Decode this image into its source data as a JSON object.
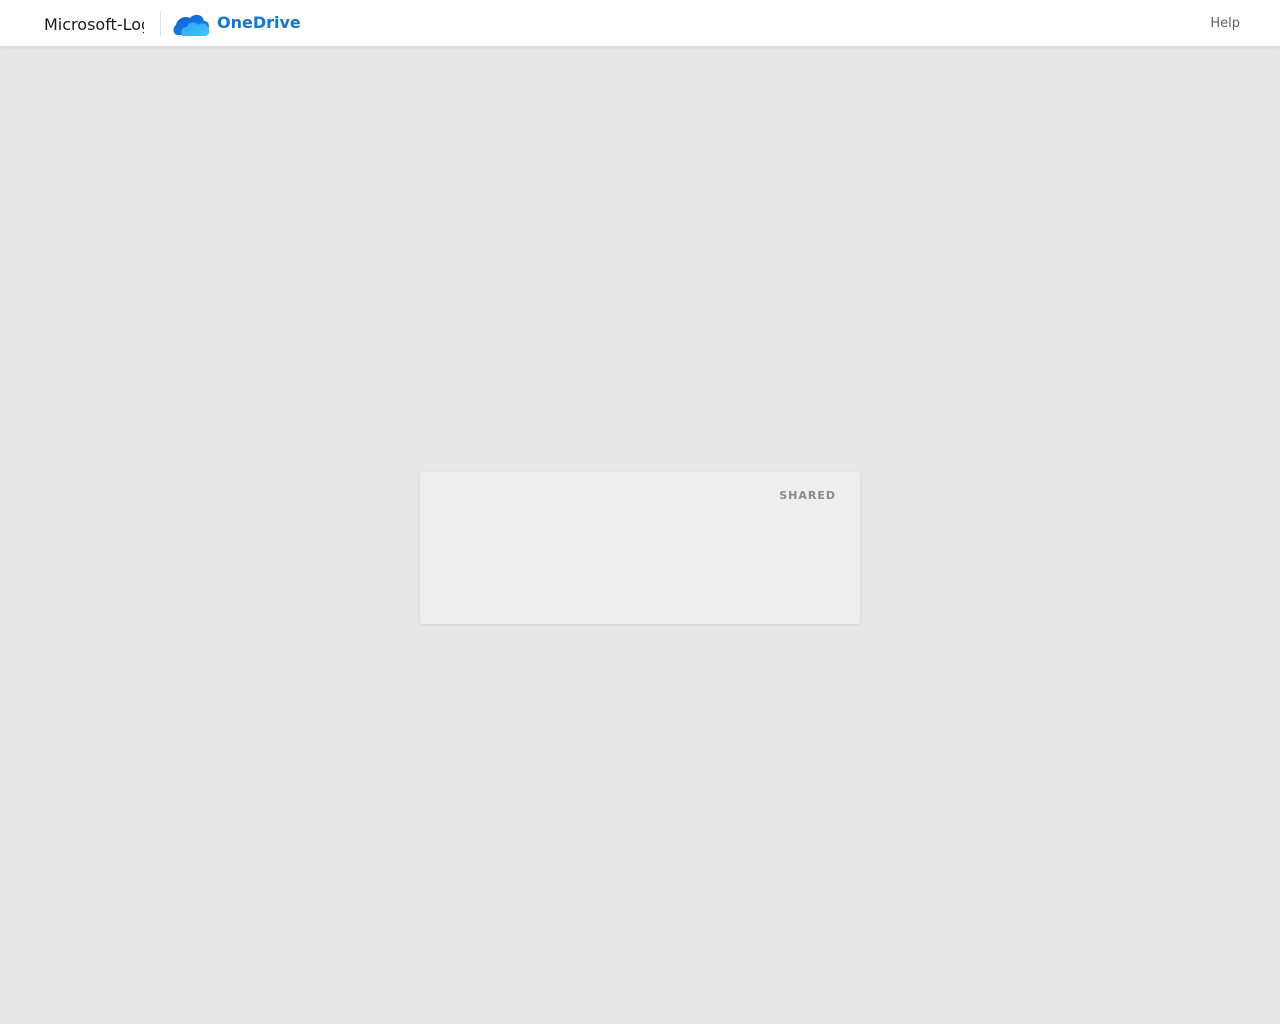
{
  "header": {
    "brand_text": "Microsoft-Logo",
    "app_name": "OneDrive",
    "app_name_color": "#0f78d4",
    "help_label": "Help"
  },
  "card": {
    "badge": "SHARED"
  },
  "icons": {
    "app_logo": "onedrive-cloud-icon"
  }
}
